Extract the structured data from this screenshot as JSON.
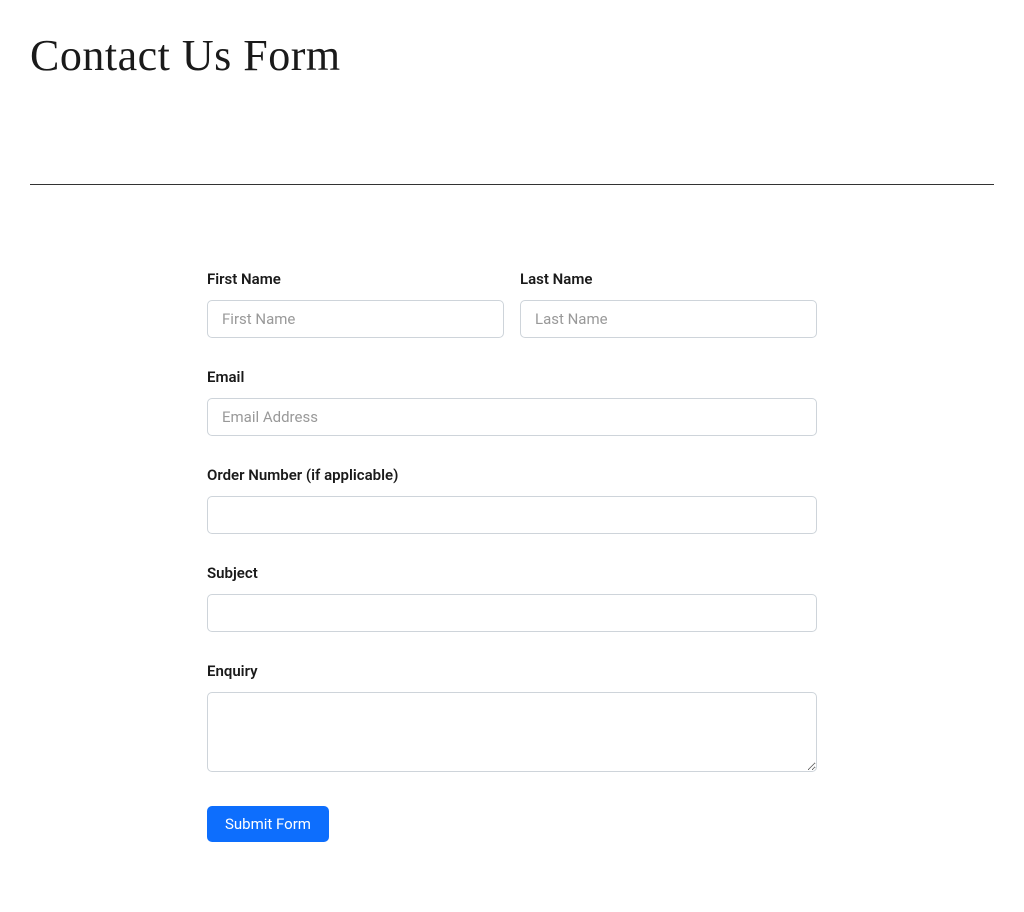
{
  "page": {
    "title": "Contact Us Form"
  },
  "form": {
    "first_name": {
      "label": "First Name",
      "placeholder": "First Name",
      "value": ""
    },
    "last_name": {
      "label": "Last Name",
      "placeholder": "Last Name",
      "value": ""
    },
    "email": {
      "label": "Email",
      "placeholder": "Email Address",
      "value": ""
    },
    "order_number": {
      "label": "Order Number (if applicable)",
      "placeholder": "",
      "value": ""
    },
    "subject": {
      "label": "Subject",
      "placeholder": "",
      "value": ""
    },
    "enquiry": {
      "label": "Enquiry",
      "placeholder": "",
      "value": ""
    },
    "submit": {
      "label": "Submit Form"
    }
  }
}
